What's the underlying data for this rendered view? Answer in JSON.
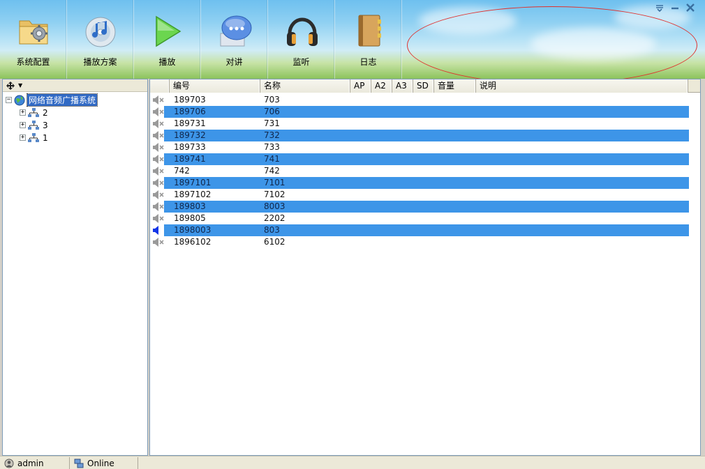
{
  "window": {
    "controls": [
      "dropdown-icon",
      "minimize-icon",
      "close-icon"
    ]
  },
  "toolbar": {
    "buttons": [
      {
        "label": "系统配置",
        "icon": "folder-gear-icon"
      },
      {
        "label": "播放方案",
        "icon": "music-cd-icon"
      },
      {
        "label": "播放",
        "icon": "play-icon"
      },
      {
        "label": "对讲",
        "icon": "chat-bubble-icon"
      },
      {
        "label": "监听",
        "icon": "headphones-icon"
      },
      {
        "label": "日志",
        "icon": "log-book-icon"
      }
    ]
  },
  "tree": {
    "root_label": "网络音频广播系统",
    "root_expander": "−",
    "children": [
      {
        "label": "2",
        "expander": "+"
      },
      {
        "label": "3",
        "expander": "+"
      },
      {
        "label": "1",
        "expander": "+"
      }
    ]
  },
  "list": {
    "columns": [
      "编号",
      "名称",
      "AP",
      "A2",
      "A3",
      "SD",
      "音量",
      "说明"
    ],
    "rows": [
      {
        "id": "189703",
        "name": "703",
        "selected": false,
        "speaker": "muted"
      },
      {
        "id": "189706",
        "name": "706",
        "selected": true,
        "speaker": "muted"
      },
      {
        "id": "189731",
        "name": "731",
        "selected": false,
        "speaker": "muted"
      },
      {
        "id": "189732",
        "name": "732",
        "selected": true,
        "speaker": "muted"
      },
      {
        "id": "189733",
        "name": "733",
        "selected": false,
        "speaker": "muted"
      },
      {
        "id": "189741",
        "name": "741",
        "selected": true,
        "speaker": "muted"
      },
      {
        "id": "742",
        "name": "742",
        "selected": false,
        "speaker": "muted"
      },
      {
        "id": "1897101",
        "name": "7101",
        "selected": true,
        "speaker": "muted"
      },
      {
        "id": "1897102",
        "name": "7102",
        "selected": false,
        "speaker": "muted"
      },
      {
        "id": "189803",
        "name": "8003",
        "selected": true,
        "speaker": "muted"
      },
      {
        "id": "189805",
        "name": "2202",
        "selected": false,
        "speaker": "muted"
      },
      {
        "id": "1898003",
        "name": "803",
        "selected": true,
        "speaker": "active"
      },
      {
        "id": "1896102",
        "name": "6102",
        "selected": false,
        "speaker": "muted"
      }
    ]
  },
  "status": {
    "user": "admin",
    "connection": "Online"
  },
  "colors": {
    "selection": "#3d95e8",
    "annotation_ellipse": "#e0302c",
    "active_speaker": "#1336e8"
  }
}
